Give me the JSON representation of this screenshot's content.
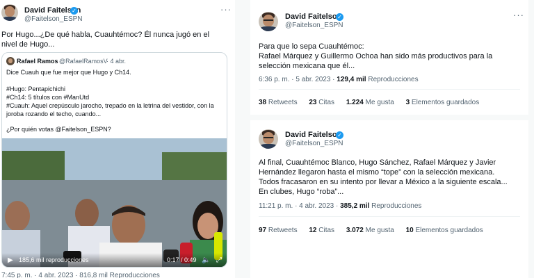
{
  "left_tweet": {
    "author_name": "David Faitelson",
    "author_handle": "@Faitelson_ESPN",
    "text": "Por Hugo...¿De qué habla, Cuauhtémoc? Él nunca jugó en el nivel de Hugo...",
    "quoted": {
      "author_name": "Rafael Ramos",
      "author_handle": "@RafaelRamosV",
      "date": "· 4 abr.",
      "lines": [
        "Dice Cuauh que fue mejor que Hugo y Ch14.",
        "",
        "#Hugo: Pentapichichi",
        "#Ch14: 5 títulos con #ManUtd",
        "#Cuauh: Aquel crepúsculo jarocho, trepado en la letrina del vestidor, con la",
        "joroba rozando el techo, cuando...",
        "",
        "¿Por quién votas @Faitelson_ESPN?"
      ],
      "video_views": "185,6 mil reproducciones",
      "video_time": "0:17 / 0:49"
    },
    "footer": "7:45 p. m. · 4 abr. 2023 · 816,8 mil Reproducciones"
  },
  "top_right_tweet": {
    "author_name": "David Faitelson",
    "author_handle": "@Faitelson_ESPN",
    "text_lines": [
      "Para que lo sepa Cuauhtémoc:",
      "Rafael Márquez y Guillermo Ochoa han sido más productivos para la",
      "selección mexicana que él..."
    ],
    "time": "6:36 p. m. · 5 abr. 2023 · ",
    "views": "129,4 mil",
    "views_label": " Reproducciones",
    "stats": [
      {
        "num": "38",
        "label": " Retweets"
      },
      {
        "num": "23",
        "label": " Citas"
      },
      {
        "num": "1.224",
        "label": " Me gusta"
      },
      {
        "num": "3",
        "label": " Elementos guardados"
      }
    ]
  },
  "bottom_right_tweet": {
    "author_name": "David Faitelson",
    "author_handle": "@Faitelson_ESPN",
    "text_lines": [
      "Al final, Cuauhtémoc Blanco, Hugo Sánchez, Rafael Márquez y Javier",
      "Hernández llegaron hasta el mismo “tope” con la selección mexicana.",
      "Todos fracasaron en su intento por llevar a México a la siguiente escala...",
      "En clubes, Hugo “roba”..."
    ],
    "time": "11:21 p. m. · 4 abr. 2023 · ",
    "views": "385,2 mil",
    "views_label": " Reproducciones",
    "stats": [
      {
        "num": "97",
        "label": " Retweets"
      },
      {
        "num": "12",
        "label": " Citas"
      },
      {
        "num": "3.072",
        "label": " Me gusta"
      },
      {
        "num": "10",
        "label": " Elementos guardados"
      }
    ]
  },
  "icons": {
    "verified": "verified-badge-icon",
    "more": "more-icon",
    "play": "play-icon",
    "volume": "volume-icon",
    "expand": "expand-icon"
  },
  "colors": {
    "accent": "#1d9bf0",
    "secondary_text": "#536471",
    "border": "#cfd9de"
  }
}
